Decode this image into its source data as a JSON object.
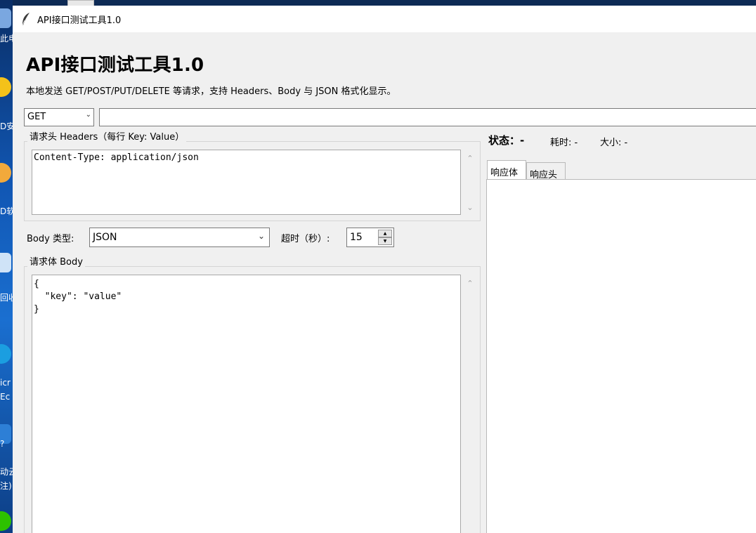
{
  "window": {
    "title": "API接口测试工具1.0"
  },
  "header": {
    "heading": "API接口测试工具1.0",
    "description": "本地发送 GET/POST/PUT/DELETE 等请求，支持 Headers、Body 与 JSON 格式化显示。"
  },
  "request": {
    "method": "GET",
    "url": "",
    "headers_frame_title": "请求头 Headers（每行 Key: Value）",
    "headers_lines": [
      "Content-Type: application/json"
    ],
    "body_type_label": "Body 类型:",
    "body_type_value": "JSON",
    "timeout_label": "超时（秒）:",
    "timeout_value": "15",
    "body_frame_title": "请求体 Body",
    "body_lines": [
      "{",
      "  \"key\": \"value\"",
      "}"
    ]
  },
  "response": {
    "status_label": "状态：-",
    "time_label": "耗时: -",
    "size_label": "大小: -",
    "tabs": [
      {
        "label": "响应体"
      },
      {
        "label": "响应头"
      }
    ]
  },
  "desktop": {
    "icon_labels": [
      "此电",
      "D安",
      "D软",
      "回收",
      "icr",
      "Ec",
      "?",
      "动云",
      "注)"
    ]
  },
  "colors": {
    "desktop_blue": "#0b3a78",
    "window_bg": "#f0f0f0",
    "titlebar_bg": "#ffffff"
  }
}
